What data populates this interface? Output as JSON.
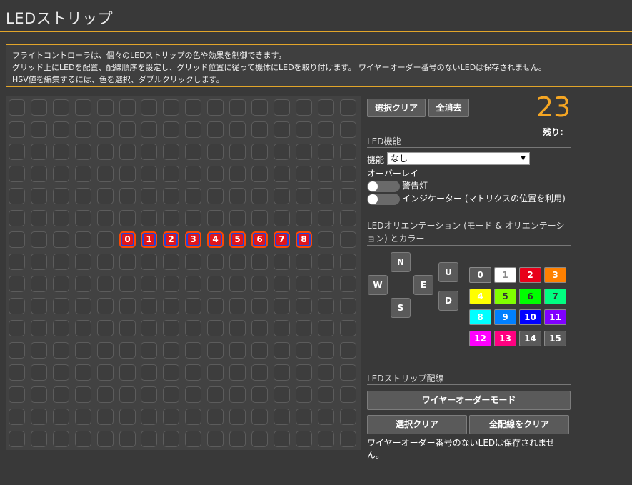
{
  "header": {
    "title": "LEDストリップ"
  },
  "notice": {
    "lines": [
      "フライトコントローラは、個々のLEDストリップの色や効果を制御できます。",
      "グリッド上にLEDを配置、配線順序を設定し、グリッド位置に従って機体にLEDを取り付けます。 ワイヤーオーダー番号のないLEDは保存されません。",
      "HSV値を編集するには、色を選択、ダブルクリックします。"
    ]
  },
  "grid": {
    "rows": 16,
    "cols": 16,
    "led_row": 6,
    "leds": [
      {
        "col": 5,
        "label": "0"
      },
      {
        "col": 6,
        "label": "1"
      },
      {
        "col": 7,
        "label": "2"
      },
      {
        "col": 8,
        "label": "3"
      },
      {
        "col": 9,
        "label": "4"
      },
      {
        "col": 10,
        "label": "5"
      },
      {
        "col": 11,
        "label": "6"
      },
      {
        "col": 12,
        "label": "7"
      },
      {
        "col": 13,
        "label": "8"
      }
    ]
  },
  "toolbar": {
    "clear_selection": "選択クリア",
    "clear_all": "全消去"
  },
  "counter": {
    "value": "23",
    "label": "残り:"
  },
  "function": {
    "section_title": "LED機能",
    "label": "機能",
    "selected": "なし",
    "overlay_label": "オーバーレイ",
    "toggles": [
      {
        "label": "警告灯",
        "on": false
      },
      {
        "label": "インジケーター (マトリクスの位置を利用)",
        "on": false
      }
    ]
  },
  "orientation": {
    "section_title": "LEDオリエンテーション (モード & オリエンテーション) とカラー",
    "directions": {
      "n": "N",
      "w": "W",
      "e": "E",
      "s": "S",
      "u": "U",
      "d": "D"
    }
  },
  "colors": [
    {
      "label": "0",
      "bg": "#5a5a5a",
      "fg": "#ffffff"
    },
    {
      "label": "1",
      "bg": "#ffffff",
      "fg": "#888888"
    },
    {
      "label": "2",
      "bg": "#e8001a",
      "fg": "#ffffff"
    },
    {
      "label": "3",
      "bg": "#ff8000",
      "fg": "#ffffff"
    },
    {
      "label": "4",
      "bg": "#ffff00",
      "fg": "#ffffff"
    },
    {
      "label": "5",
      "bg": "#80ff00",
      "fg": "#333333"
    },
    {
      "label": "6",
      "bg": "#00ff00",
      "fg": "#333333"
    },
    {
      "label": "7",
      "bg": "#00ff80",
      "fg": "#333333"
    },
    {
      "label": "8",
      "bg": "#00ffff",
      "fg": "#ffffff"
    },
    {
      "label": "9",
      "bg": "#0080ff",
      "fg": "#ffffff"
    },
    {
      "label": "10",
      "bg": "#0000ff",
      "fg": "#ffffff"
    },
    {
      "label": "11",
      "bg": "#8000ff",
      "fg": "#ffffff"
    },
    {
      "label": "12",
      "bg": "#ff00ff",
      "fg": "#ffffff"
    },
    {
      "label": "13",
      "bg": "#ff0080",
      "fg": "#ffffff"
    },
    {
      "label": "14",
      "bg": "#5a5a5a",
      "fg": "#ffffff"
    },
    {
      "label": "15",
      "bg": "#5a5a5a",
      "fg": "#ffffff"
    }
  ],
  "wiring": {
    "section_title": "LEDストリップ配線",
    "wire_order_mode": "ワイヤーオーダーモード",
    "clear_selection": "選択クリア",
    "clear_all_wiring": "全配線をクリア",
    "note": "ワイヤーオーダー番号のないLEDは保存されません。"
  }
}
